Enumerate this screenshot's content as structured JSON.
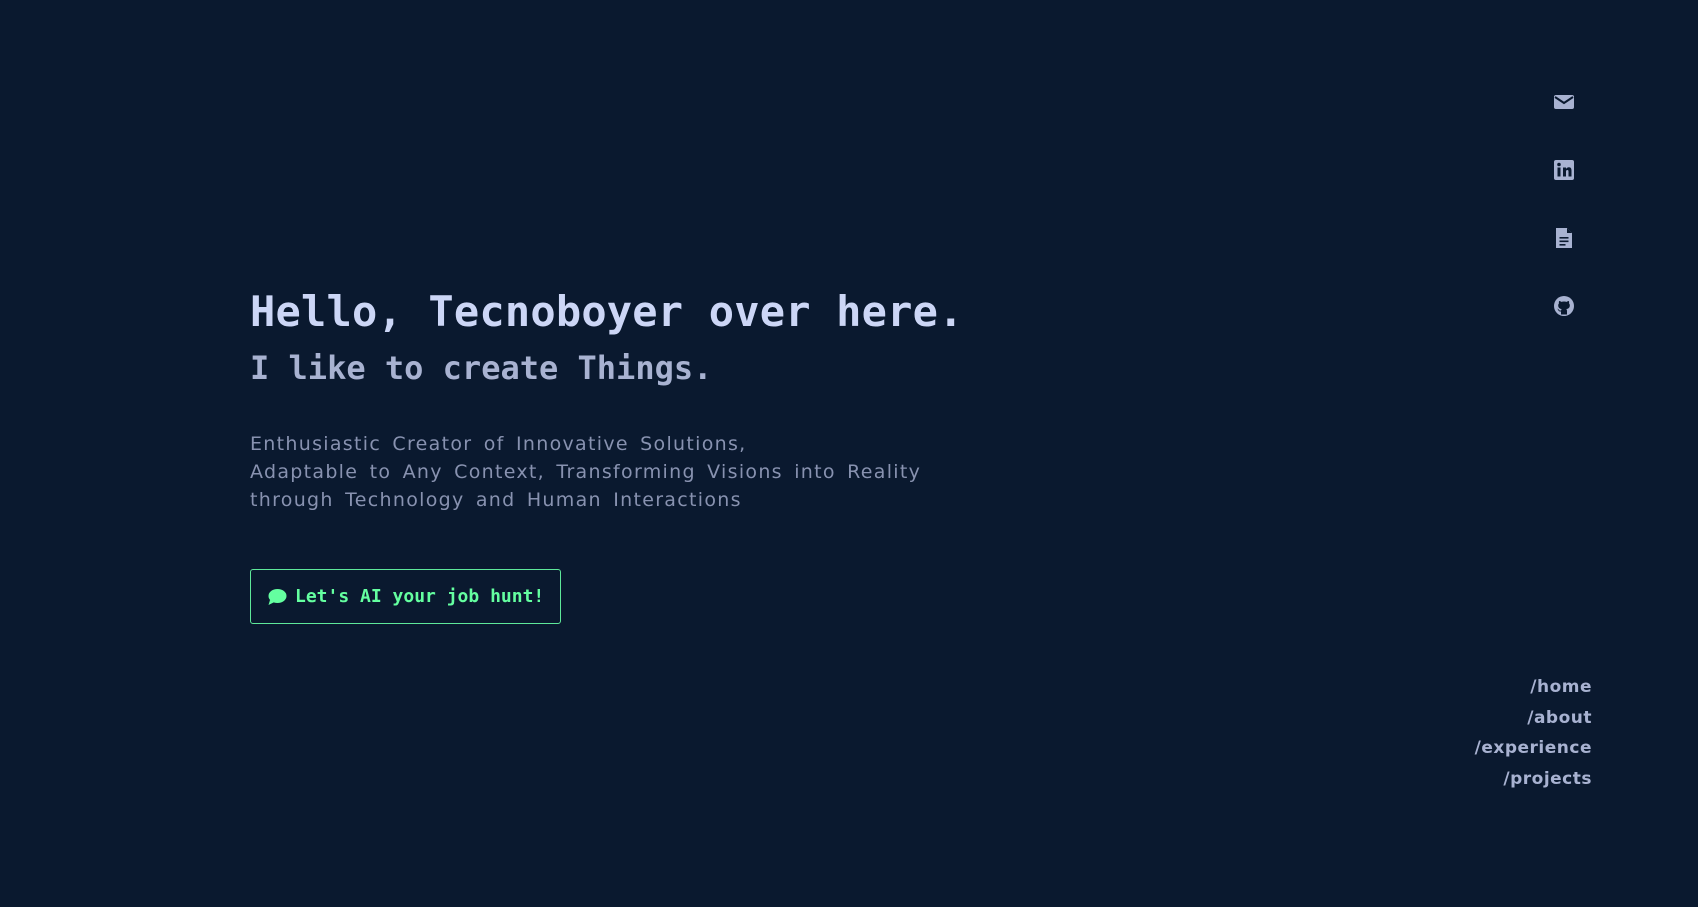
{
  "hero": {
    "title": "Hello, Tecnoboyer over here.",
    "subtitle": "I like to create Things.",
    "description_lines": [
      "Enthusiastic Creator of Innovative Solutions,",
      "Adaptable to Any Context, Transforming Visions into Reality",
      "through Technology and Human Interactions"
    ],
    "cta_label": "Let's AI your job hunt!",
    "cta_icon": "chat-bubble-icon"
  },
  "social_links": [
    {
      "name": "email",
      "icon": "mail-icon"
    },
    {
      "name": "linkedin",
      "icon": "linkedin-icon"
    },
    {
      "name": "resume",
      "icon": "document-icon"
    },
    {
      "name": "github",
      "icon": "github-icon"
    }
  ],
  "nav": {
    "items": [
      "/home",
      "/about",
      "/experience",
      "/projects"
    ]
  },
  "colors": {
    "background": "#0a192f",
    "title": "#ccd6f6",
    "subtitle": "#a8b2d1",
    "body": "#8892b0",
    "accent": "#64ffa0"
  }
}
